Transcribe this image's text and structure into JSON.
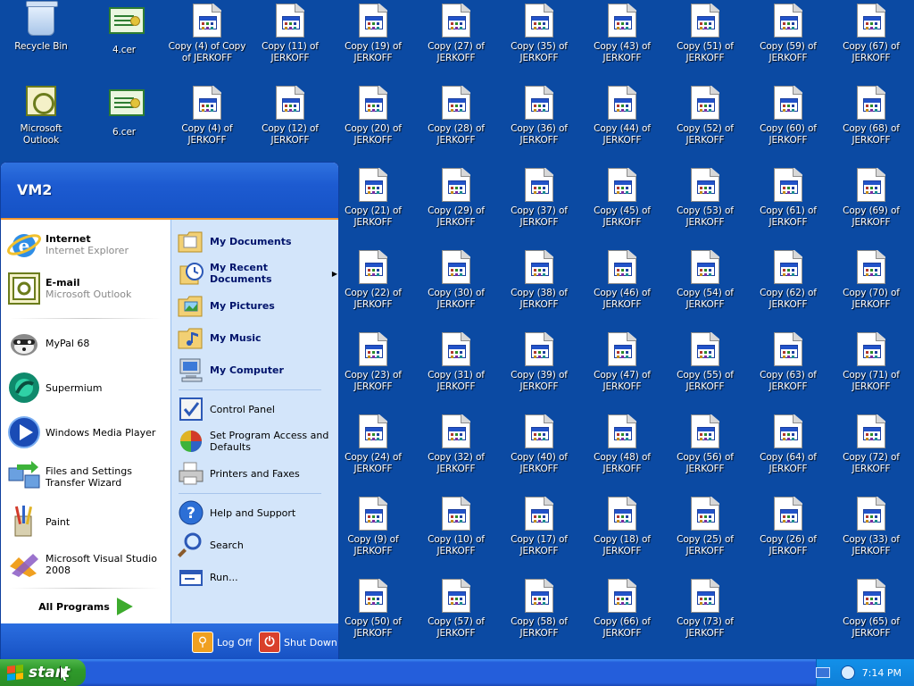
{
  "desktop": {
    "background_color": "#0b4aa3",
    "icons": [
      {
        "label": "Recycle Bin",
        "type": "recycle-bin"
      },
      {
        "label": "4.cer",
        "type": "certificate"
      },
      {
        "label": "Copy (4) of Copy of JERKOFF",
        "type": "document"
      },
      {
        "label": "Copy (11) of JERKOFF",
        "type": "document"
      },
      {
        "label": "Copy (19) of JERKOFF",
        "type": "document"
      },
      {
        "label": "Copy (27) of JERKOFF",
        "type": "document"
      },
      {
        "label": "Copy (35) of JERKOFF",
        "type": "document"
      },
      {
        "label": "Copy (43) of JERKOFF",
        "type": "document"
      },
      {
        "label": "Copy (51) of JERKOFF",
        "type": "document"
      },
      {
        "label": "Copy (59) of JERKOFF",
        "type": "document"
      },
      {
        "label": "Copy (67) of JERKOFF",
        "type": "document"
      },
      {
        "label": "Microsoft Outlook",
        "type": "outlook"
      },
      {
        "label": "6.cer",
        "type": "certificate"
      },
      {
        "label": "Copy (4) of JERKOFF",
        "type": "document"
      },
      {
        "label": "Copy (12) of JERKOFF",
        "type": "document"
      },
      {
        "label": "Copy (20) of JERKOFF",
        "type": "document"
      },
      {
        "label": "Copy (28) of JERKOFF",
        "type": "document"
      },
      {
        "label": "Copy (36) of JERKOFF",
        "type": "document"
      },
      {
        "label": "Copy (44) of JERKOFF",
        "type": "document"
      },
      {
        "label": "Copy (52) of JERKOFF",
        "type": "document"
      },
      {
        "label": "Copy (60) of JERKOFF",
        "type": "document"
      },
      {
        "label": "Copy (68) of JERKOFF",
        "type": "document"
      },
      {
        "label": "Copy (21) of JERKOFF",
        "type": "document"
      },
      {
        "label": "Copy (29) of JERKOFF",
        "type": "document"
      },
      {
        "label": "Copy (37) of JERKOFF",
        "type": "document"
      },
      {
        "label": "Copy (45) of JERKOFF",
        "type": "document"
      },
      {
        "label": "Copy (53) of JERKOFF",
        "type": "document"
      },
      {
        "label": "Copy (61) of JERKOFF",
        "type": "document"
      },
      {
        "label": "Copy (69) of JERKOFF",
        "type": "document"
      },
      {
        "label": "Copy (22) of JERKOFF",
        "type": "document"
      },
      {
        "label": "Copy (30) of JERKOFF",
        "type": "document"
      },
      {
        "label": "Copy (38) of JERKOFF",
        "type": "document"
      },
      {
        "label": "Copy (46) of JERKOFF",
        "type": "document"
      },
      {
        "label": "Copy (54) of JERKOFF",
        "type": "document"
      },
      {
        "label": "Copy (62) of JERKOFF",
        "type": "document"
      },
      {
        "label": "Copy (70) of JERKOFF",
        "type": "document"
      },
      {
        "label": "Copy (23) of JERKOFF",
        "type": "document"
      },
      {
        "label": "Copy (31) of JERKOFF",
        "type": "document"
      },
      {
        "label": "Copy (39) of JERKOFF",
        "type": "document"
      },
      {
        "label": "Copy (47) of JERKOFF",
        "type": "document"
      },
      {
        "label": "Copy (55) of JERKOFF",
        "type": "document"
      },
      {
        "label": "Copy (63) of JERKOFF",
        "type": "document"
      },
      {
        "label": "Copy (71) of JERKOFF",
        "type": "document"
      },
      {
        "label": "Copy (24) of JERKOFF",
        "type": "document"
      },
      {
        "label": "Copy (32) of JERKOFF",
        "type": "document"
      },
      {
        "label": "Copy (40) of JERKOFF",
        "type": "document"
      },
      {
        "label": "Copy (48) of JERKOFF",
        "type": "document"
      },
      {
        "label": "Copy (56) of JERKOFF",
        "type": "document"
      },
      {
        "label": "Copy (64) of JERKOFF",
        "type": "document"
      },
      {
        "label": "Copy (72) of JERKOFF",
        "type": "document"
      },
      {
        "label": "Copy (9) of JERKOFF",
        "type": "document"
      },
      {
        "label": "Copy (10) of JERKOFF",
        "type": "document"
      },
      {
        "label": "Copy (17) of JERKOFF",
        "type": "document"
      },
      {
        "label": "Copy (18) of JERKOFF",
        "type": "document"
      },
      {
        "label": "Copy (25) of JERKOFF",
        "type": "document"
      },
      {
        "label": "Copy (26) of JERKOFF",
        "type": "document"
      },
      {
        "label": "Copy (33) of JERKOFF",
        "type": "document"
      },
      {
        "label": "Copy (50) of JERKOFF",
        "type": "document"
      },
      {
        "label": "Copy (57) of JERKOFF",
        "type": "document"
      },
      {
        "label": "Copy (58) of JERKOFF",
        "type": "document"
      },
      {
        "label": "Copy (66) of JERKOFF",
        "type": "document"
      },
      {
        "label": "Copy (73) of JERKOFF",
        "type": "document"
      },
      {
        "label": "Copy (65) of JERKOFF",
        "type": "document"
      }
    ]
  },
  "start_menu": {
    "user_name": "VM2",
    "pinned": [
      {
        "title": "Internet",
        "subtitle": "Internet Explorer",
        "icon": "internet-explorer-icon"
      },
      {
        "title": "E-mail",
        "subtitle": "Microsoft Outlook",
        "icon": "outlook-icon"
      }
    ],
    "recent": [
      {
        "label": "MyPal 68",
        "icon": "mypal-icon"
      },
      {
        "label": "Supermium",
        "icon": "supermium-icon"
      },
      {
        "label": "Windows Media Player",
        "icon": "media-player-icon"
      },
      {
        "label": "Files and Settings Transfer Wizard",
        "icon": "transfer-wizard-icon"
      },
      {
        "label": "Paint",
        "icon": "paint-icon"
      },
      {
        "label": "Microsoft Visual Studio 2008",
        "icon": "visual-studio-icon"
      }
    ],
    "all_programs_label": "All Programs",
    "places": [
      {
        "label": "My Documents",
        "icon": "my-documents-icon",
        "bold": true,
        "submenu": false
      },
      {
        "label": "My Recent Documents",
        "icon": "recent-documents-icon",
        "bold": true,
        "submenu": true
      },
      {
        "label": "My Pictures",
        "icon": "my-pictures-icon",
        "bold": true,
        "submenu": false
      },
      {
        "label": "My Music",
        "icon": "my-music-icon",
        "bold": true,
        "submenu": false
      },
      {
        "label": "My Computer",
        "icon": "my-computer-icon",
        "bold": true,
        "submenu": false
      }
    ],
    "settings": [
      {
        "label": "Control Panel",
        "icon": "control-panel-icon"
      },
      {
        "label": "Set Program Access and Defaults",
        "icon": "program-defaults-icon"
      },
      {
        "label": "Printers and Faxes",
        "icon": "printer-icon"
      }
    ],
    "help": [
      {
        "label": "Help and Support",
        "icon": "help-icon"
      },
      {
        "label": "Search",
        "icon": "search-icon"
      },
      {
        "label": "Run...",
        "icon": "run-icon"
      }
    ],
    "log_off_label": "Log Off",
    "shut_down_label": "Shut Down"
  },
  "taskbar": {
    "start_label": "start",
    "clock": "7:14 PM"
  }
}
